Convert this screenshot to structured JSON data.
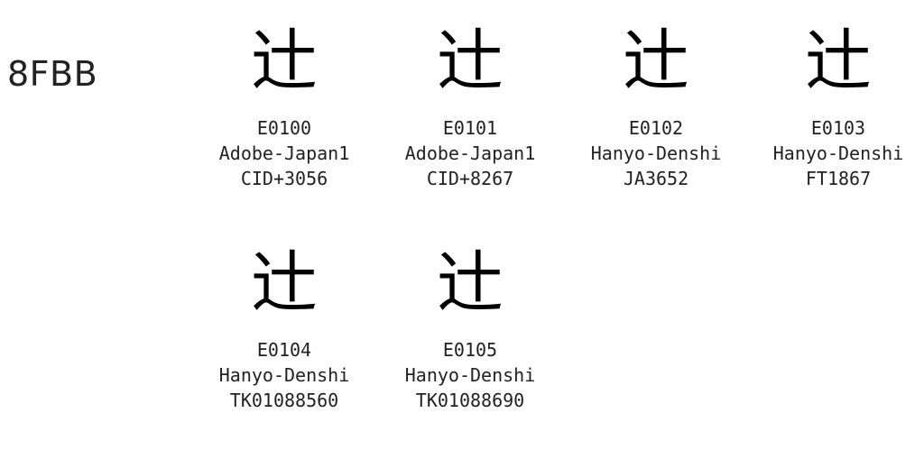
{
  "codepoint": "8FBB",
  "glyph": "辻",
  "variants": [
    {
      "selector": "E0100",
      "collection": "Adobe-Japan1",
      "id": "CID+3056"
    },
    {
      "selector": "E0101",
      "collection": "Adobe-Japan1",
      "id": "CID+8267"
    },
    {
      "selector": "E0102",
      "collection": "Hanyo-Denshi",
      "id": "JA3652"
    },
    {
      "selector": "E0103",
      "collection": "Hanyo-Denshi",
      "id": "FT1867"
    },
    {
      "selector": "E0104",
      "collection": "Hanyo-Denshi",
      "id": "TK01088560"
    },
    {
      "selector": "E0105",
      "collection": "Hanyo-Denshi",
      "id": "TK01088690"
    }
  ]
}
